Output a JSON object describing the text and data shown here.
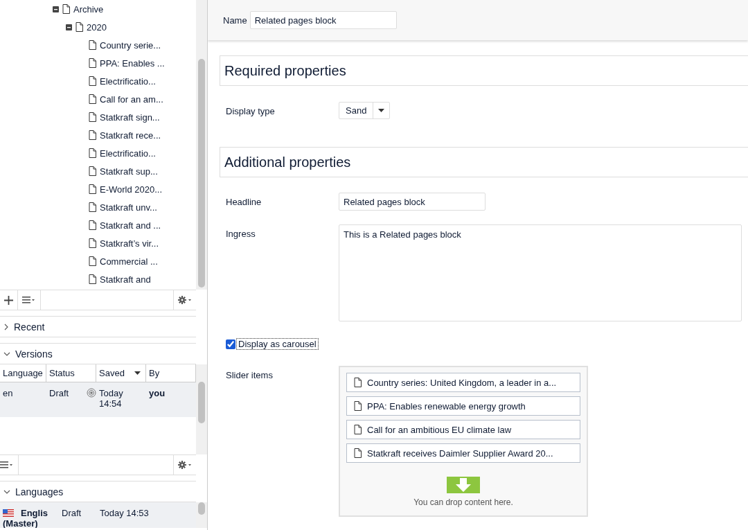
{
  "tree": {
    "items": [
      {
        "label": "Archive",
        "expanded": true,
        "children": [
          {
            "label": "2020",
            "expanded": true,
            "children": [
              {
                "label": "Country serie..."
              },
              {
                "label": "PPA: Enables ..."
              },
              {
                "label": "Electrificatio..."
              },
              {
                "label": "Call for an am..."
              },
              {
                "label": "Statkraft sign..."
              },
              {
                "label": "Statkraft rece..."
              },
              {
                "label": "Electrificatio..."
              },
              {
                "label": "Statkraft sup..."
              },
              {
                "label": "E-World 2020..."
              },
              {
                "label": "Statkraft unv..."
              },
              {
                "label": "Statkraft and ..."
              },
              {
                "label": "Statkraft’s vir..."
              },
              {
                "label": "Commercial ..."
              },
              {
                "label": "Statkraft and"
              }
            ]
          }
        ]
      }
    ]
  },
  "recent": {
    "title": "Recent",
    "expanded": false
  },
  "versions": {
    "title": "Versions",
    "expanded": true,
    "columns": [
      {
        "label": "Language",
        "sorted": false
      },
      {
        "label": "Status",
        "sorted": false
      },
      {
        "label": "Saved",
        "sorted": true
      },
      {
        "label": "By",
        "sorted": false
      }
    ],
    "rows": [
      {
        "language": "en",
        "status": "Draft",
        "saved": "Today 14:54",
        "by": "you",
        "selected": true
      }
    ]
  },
  "languages": {
    "title": "Languages",
    "expanded": true,
    "rows": [
      {
        "name": "Englis",
        "note": "(Master)",
        "status": "Draft",
        "saved": "Today 14:53",
        "selected": true
      }
    ]
  },
  "form": {
    "name": {
      "label": "Name",
      "value": "Related pages block"
    },
    "sections": [
      {
        "title": "Required properties",
        "fields": [
          {
            "kind": "select",
            "label": "Display type",
            "value": "Sand"
          }
        ]
      },
      {
        "title": "Additional properties",
        "fields": [
          {
            "kind": "text",
            "label": "Headline",
            "value": "Related pages block"
          },
          {
            "kind": "textarea",
            "label": "Ingress",
            "value": "This is a Related pages block"
          },
          {
            "kind": "checkbox",
            "label": "Display as carousel",
            "checked": true
          },
          {
            "kind": "content_area",
            "label": "Slider items",
            "hint": "You can drop content here.",
            "items": [
              {
                "label": "Country series: United Kingdom, a leader in a..."
              },
              {
                "label": "PPA: Enables renewable energy growth"
              },
              {
                "label": "Call for an ambitious EU climate law"
              },
              {
                "label": "Statkraft receives Daimler Supplier Award 20..."
              }
            ]
          }
        ]
      }
    ]
  }
}
